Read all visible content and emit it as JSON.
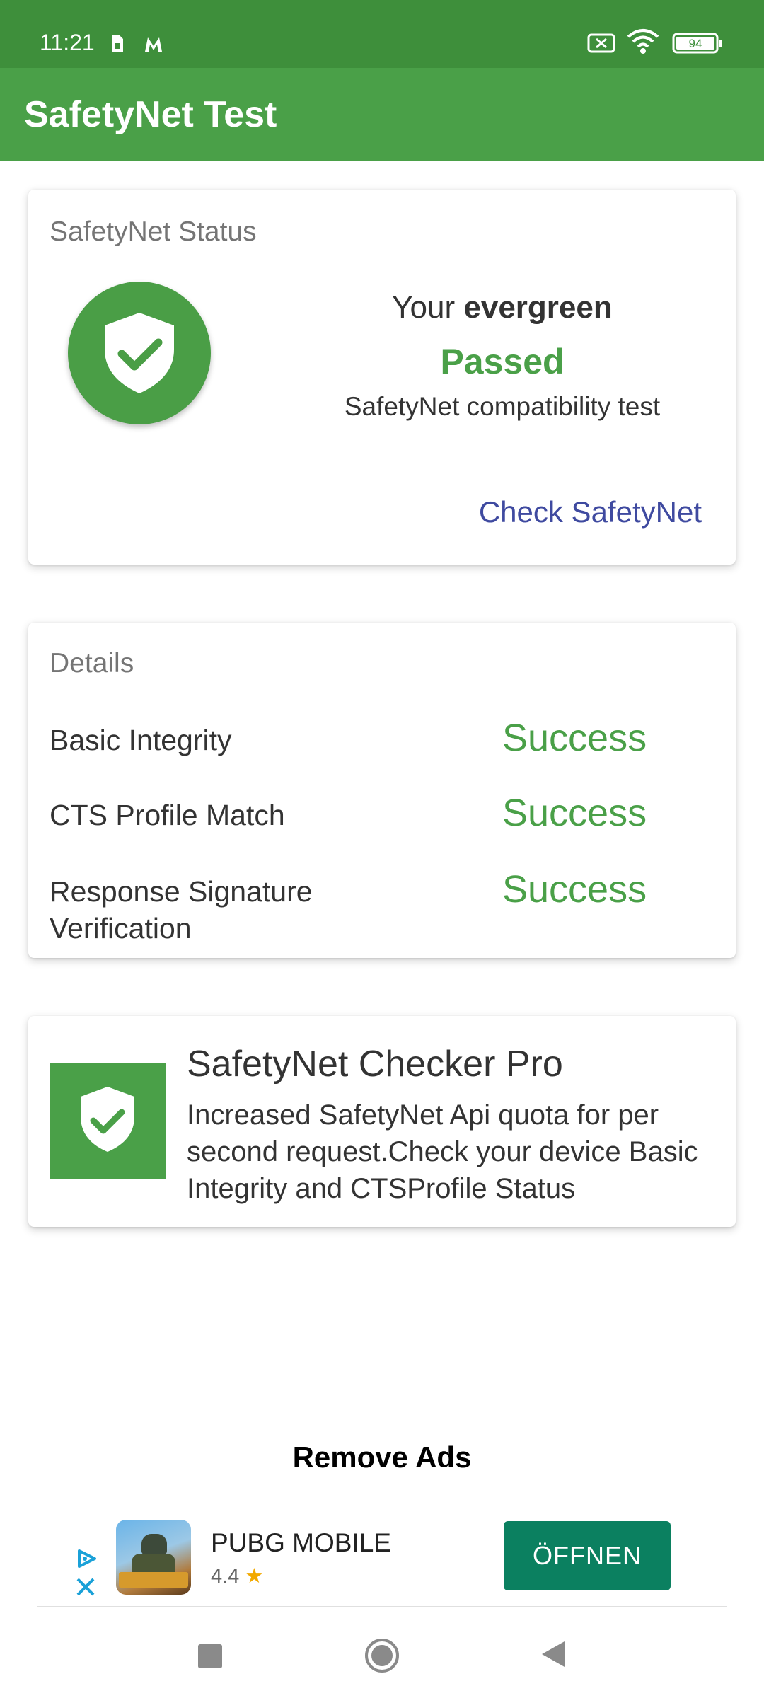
{
  "status_bar": {
    "time": "11:21",
    "battery": "94",
    "icons": [
      "sim-icon",
      "m-icon",
      "no-sim-icon",
      "wifi-icon",
      "battery-icon"
    ]
  },
  "app_bar": {
    "title": "SafetyNet Test"
  },
  "status_card": {
    "heading": "SafetyNet Status",
    "your_prefix": "Your",
    "device_name": "evergreen",
    "result": "Passed",
    "subtitle": "SafetyNet compatibility test",
    "check_button": "Check SafetyNet",
    "icon": "shield-check-icon"
  },
  "details_card": {
    "heading": "Details",
    "rows": [
      {
        "label": "Basic Integrity",
        "value": "Success"
      },
      {
        "label": "CTS Profile Match",
        "value": "Success"
      },
      {
        "label": "Response Signature Verification",
        "value": "Success"
      }
    ]
  },
  "pro_card": {
    "title": "SafetyNet Checker Pro",
    "description": "Increased SafetyNet Api quota for per second request.Check your device Basic Integrity and CTSProfile Status",
    "icon": "shield-check-icon"
  },
  "remove_ads": "Remove Ads",
  "ad": {
    "app_name": "PUBG MOBILE",
    "rating": "4.4",
    "button": "ÖFFNEN",
    "accent": "#0b8060"
  },
  "colors": {
    "status_bar": "#3e8f3b",
    "app_bar": "#4aa048",
    "success": "#4aa048",
    "link": "#3f4aa0"
  }
}
